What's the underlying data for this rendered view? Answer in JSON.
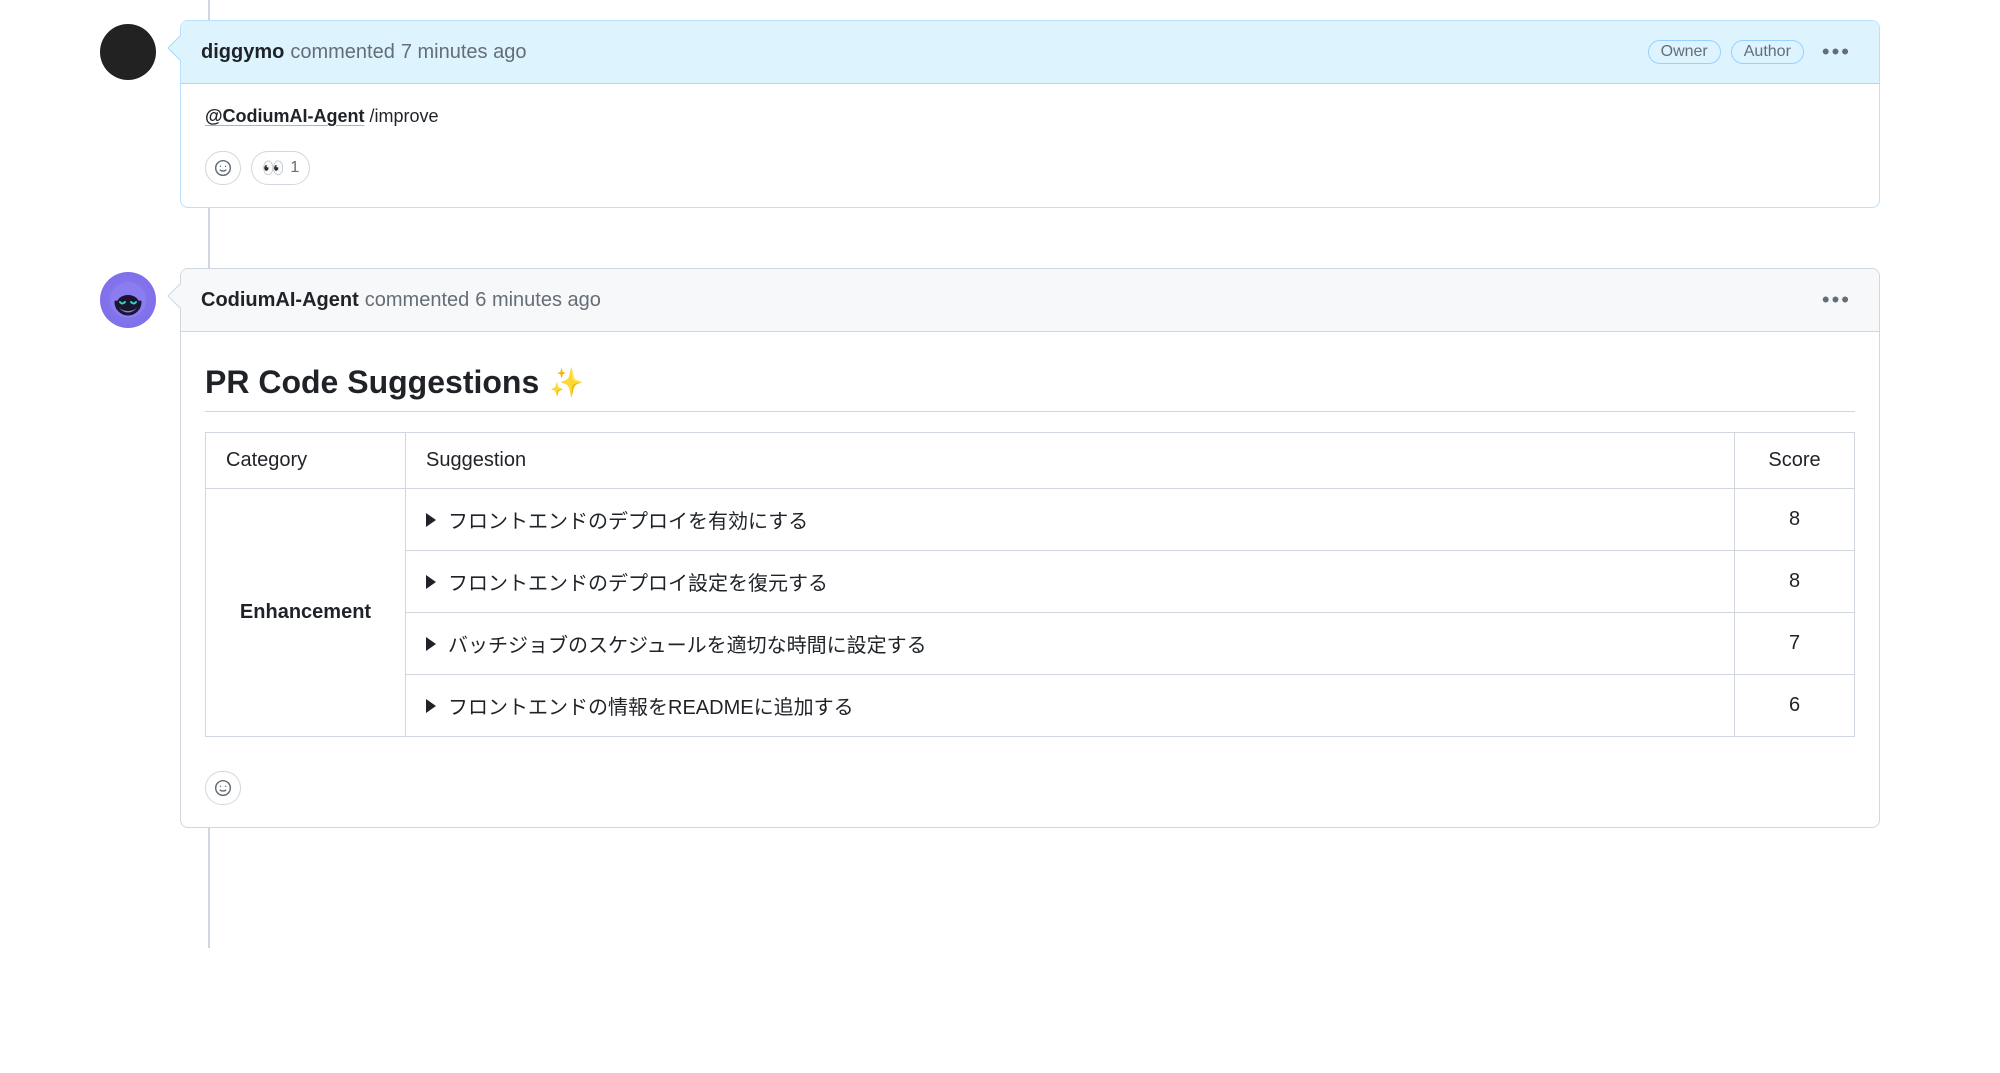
{
  "comments": [
    {
      "author": "diggymo",
      "action": "commented",
      "time": "7 minutes ago",
      "badges": [
        "Owner",
        "Author"
      ],
      "mention": "@CodiumAI-Agent",
      "command": " /improve",
      "reactions": [
        {
          "emoji": "👀",
          "count": "1"
        }
      ]
    },
    {
      "author": "CodiumAI-Agent",
      "action": "commented",
      "time": "6 minutes ago",
      "badges": [],
      "heading": "PR Code Suggestions",
      "heading_emoji": "✨",
      "table": {
        "headers": {
          "category": "Category",
          "suggestion": "Suggestion",
          "score": "Score"
        },
        "category": "Enhancement",
        "rows": [
          {
            "text": "フロントエンドのデプロイを有効にする",
            "score": "8"
          },
          {
            "text": "フロントエンドのデプロイ設定を復元する",
            "score": "8"
          },
          {
            "text": "バッチジョブのスケジュールを適切な時間に設定する",
            "score": "7"
          },
          {
            "text": "フロントエンドの情報をREADMEに追加する",
            "score": "6"
          }
        ]
      }
    }
  ]
}
